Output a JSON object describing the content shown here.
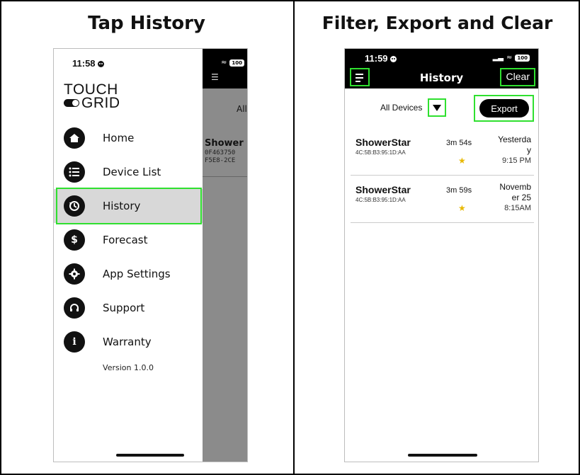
{
  "captions": {
    "left": "Tap History",
    "right": "Filter, Export and Clear"
  },
  "left_phone": {
    "status_time": "11:58",
    "battery": "100",
    "brand_line1": "TOUCH",
    "brand_line2": "GRID",
    "menu": [
      {
        "label": "Home",
        "icon": "home-icon"
      },
      {
        "label": "Device List",
        "icon": "list-icon"
      },
      {
        "label": "History",
        "icon": "history-icon",
        "active": true
      },
      {
        "label": "Forecast",
        "icon": "dollar-icon"
      },
      {
        "label": "App Settings",
        "icon": "gear-icon"
      },
      {
        "label": "Support",
        "icon": "headset-icon"
      },
      {
        "label": "Warranty",
        "icon": "info-icon"
      }
    ],
    "version": "Version 1.0.0",
    "peek": {
      "filter": "All",
      "title": "Shower",
      "sub1": "0F463750",
      "sub2": "F5E8-2CE"
    }
  },
  "right_phone": {
    "status_time": "11:59",
    "battery": "100",
    "title": "History",
    "clear_label": "Clear",
    "filter_label": "All Devices",
    "export_label": "Export",
    "rows": [
      {
        "name": "ShowerStar",
        "mac": "4C:5B:B3:95:1D:AA",
        "duration": "3m 54s",
        "date1": "Yesterda",
        "date2": "y",
        "time": "9:15 PM"
      },
      {
        "name": "ShowerStar",
        "mac": "4C:5B:B3:95:1D:AA",
        "duration": "3m 59s",
        "date1": "Novemb",
        "date2": "er 25",
        "time": "8:15AM"
      }
    ]
  },
  "colors": {
    "highlight": "#2fe02f",
    "menu_active_bg": "#d8d8d8",
    "star": "#e8b800"
  }
}
